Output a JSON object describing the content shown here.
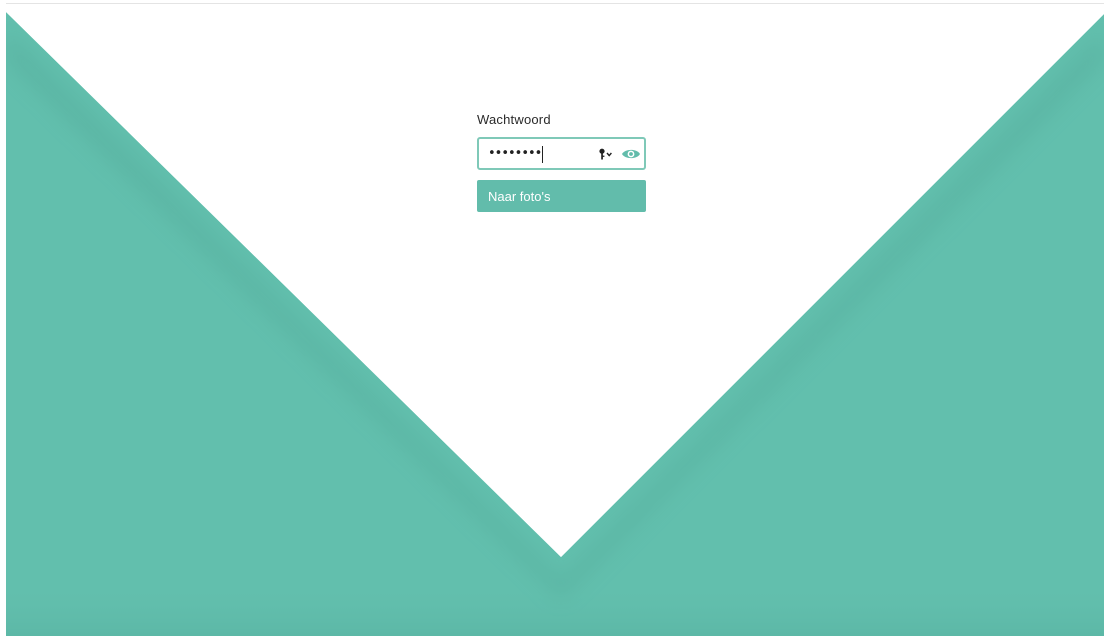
{
  "login": {
    "password_label": "Wachtwoord",
    "password_value": "••••••••",
    "submit_label": "Naar foto's"
  },
  "colors": {
    "accent": "#62bcab",
    "input_border": "#7fc9b8",
    "background": "#ffffff"
  },
  "icons": {
    "key": "key-icon",
    "reveal": "eye-icon"
  }
}
